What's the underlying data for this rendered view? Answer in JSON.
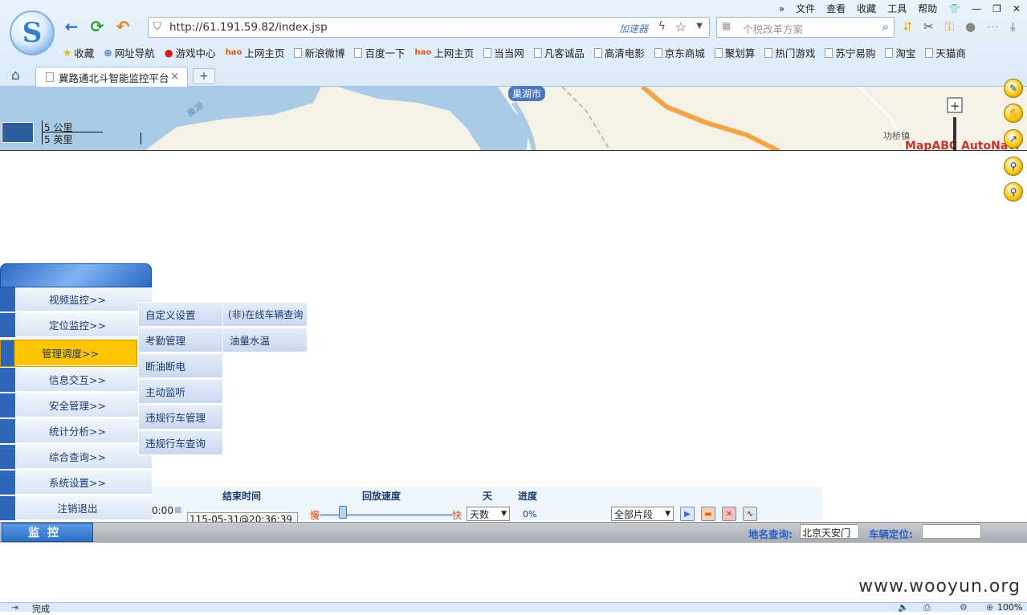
{
  "browser": {
    "menu": [
      "文件",
      "查看",
      "收藏",
      "工具",
      "帮助"
    ],
    "url": "http://61.191.59.82/index.jsp",
    "accelerator": "加速器",
    "search_placeholder": "个税改革方案",
    "bookmarks": [
      "收藏",
      "网址导航",
      "游戏中心",
      "上网主页",
      "新浪微博",
      "百度一下",
      "上网主页",
      "当当网",
      "凡客诚品",
      "高清电影",
      "京东商城",
      "聚划算",
      "热门游戏",
      "苏宁易购",
      "淘宝",
      "天猫商"
    ],
    "tab_title": "冀路通北斗智能监控平台",
    "tab_close": "×",
    "new_tab": "+"
  },
  "map": {
    "scale_km": "5 公里",
    "scale_mi": "5 英里",
    "city": "巢湖市",
    "lake": "巢湖",
    "town": "功桥镇",
    "brand": "MapABC AutoNavi"
  },
  "menu": {
    "items": [
      "视频监控>>",
      "定位监控>>",
      "管理调度>>",
      "信息交互>>",
      "安全管理>>",
      "统计分析>>",
      "综合查询>>",
      "系统设置>>",
      "注销退出"
    ],
    "active_index": 2,
    "sub_col1": [
      "自定义设置",
      "考勤管理",
      "断油断电",
      "主动监听",
      "违规行车管理",
      "违规行车查询"
    ],
    "sub_col2": [
      "(非)在线车辆查询",
      "油量水温"
    ]
  },
  "playback": {
    "headers": {
      "end_time": "结束时间",
      "speed": "回放速度",
      "day": "天",
      "progress": "进度"
    },
    "start_time_tail": "0:00",
    "end_time_value": "115-05-31@20:36:39",
    "slow": "慢",
    "fast": "快",
    "day_select": "天数",
    "progress_value": "0%",
    "segment_select": "全部片段"
  },
  "bottom": {
    "monitor_label": "监控",
    "place_query_label": "地名查询:",
    "place_query_value": "北京天安门",
    "vehicle_locate_label": "车辆定位:",
    "vehicle_locate_value": ""
  },
  "status": {
    "done": "完成",
    "zoom": "100%"
  },
  "watermark": "www.wooyun.org"
}
